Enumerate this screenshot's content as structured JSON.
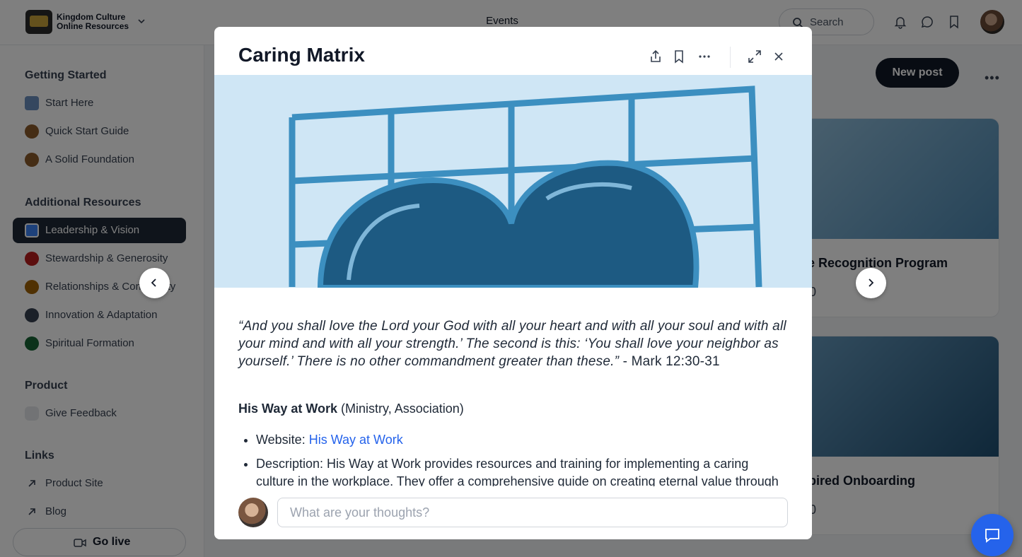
{
  "topbar": {
    "brand_line1": "Kingdom Culture",
    "brand_line2": "Online Resources",
    "title": "Events",
    "search_label": "Search"
  },
  "sidebar": {
    "sections": [
      {
        "title": "Getting Started",
        "items": [
          {
            "label": "Start Here",
            "icon": "play-icon"
          },
          {
            "label": "Quick Start Guide",
            "icon": "compass-icon"
          },
          {
            "label": "A Solid Foundation",
            "icon": "compass-icon"
          }
        ]
      },
      {
        "title": "Additional Resources",
        "items": [
          {
            "label": "Leadership & Vision",
            "icon": "leadership-icon",
            "active": true
          },
          {
            "label": "Stewardship & Generosity",
            "icon": "heart-icon"
          },
          {
            "label": "Relationships & Community",
            "icon": "people-icon"
          },
          {
            "label": "Innovation & Adaptation",
            "icon": "globe-icon"
          },
          {
            "label": "Spiritual Formation",
            "icon": "cross-icon"
          }
        ]
      },
      {
        "title": "Product",
        "items": [
          {
            "label": "Give Feedback",
            "icon": "speech-bubble-icon"
          }
        ]
      },
      {
        "title": "Links",
        "items": [
          {
            "label": "Product Site",
            "icon": "arrow-up-right-icon"
          },
          {
            "label": "Blog",
            "icon": "arrow-up-right-icon"
          }
        ]
      }
    ],
    "go_live_label": "Go live"
  },
  "main": {
    "new_post_label": "New post",
    "cards": [
      {
        "title": "yee Recognition Program",
        "comments": "0"
      },
      {
        "title": "nspired Onboarding",
        "comments": "0"
      }
    ]
  },
  "modal": {
    "title": "Caring Matrix",
    "quote": "“And you shall love the Lord your God with all your heart and with all your soul and with all your mind and with all your strength.’ The second is this: ‘You shall love your neighbor as yourself.’ There is no other commandment greater than these.”",
    "quote_ref": " - Mark 12:30-31",
    "org_name": "His Way at Work",
    "org_type": " (Ministry, Association)",
    "website_label": "Website: ",
    "website_link": "His Way at Work",
    "description": "Description: His Way at Work provides resources and training for implementing a caring culture in the workplace. They offer a comprehensive guide on creating eternal value through",
    "comment_placeholder": "What are your thoughts?"
  },
  "colors": {
    "accent": "#2563eb",
    "dark": "#1f2937",
    "hero_light": "#c8e2f3",
    "hero_dark": "#1d5a82"
  }
}
